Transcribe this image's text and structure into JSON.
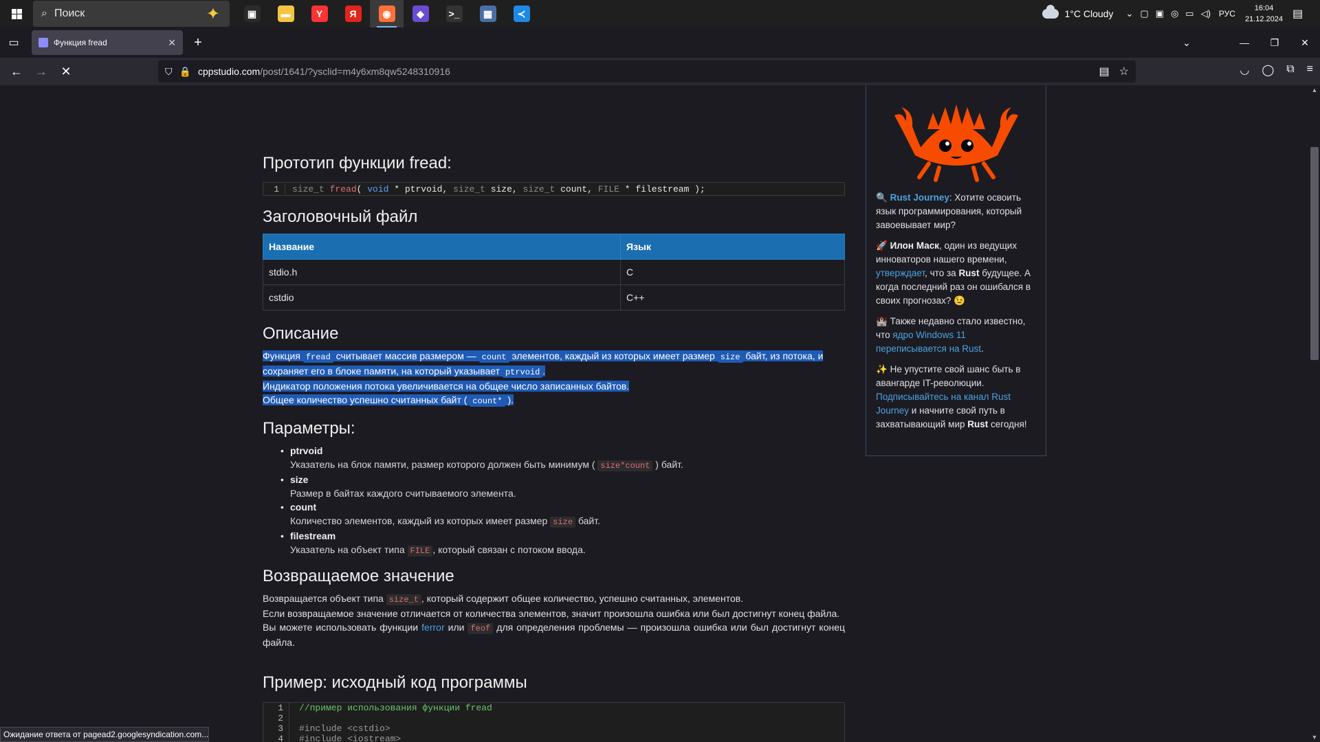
{
  "taskbar": {
    "search_placeholder": "Поиск",
    "apps": [
      {
        "name": "task-view",
        "color": "#2b2b2b",
        "glyph": "▣"
      },
      {
        "name": "file-explorer",
        "color": "#f5c542",
        "glyph": "▬"
      },
      {
        "name": "yandex-browser",
        "color": "#ff3333",
        "glyph": "Y"
      },
      {
        "name": "yandex",
        "color": "#e1251b",
        "glyph": "Я"
      },
      {
        "name": "firefox",
        "color": "#ff7139",
        "glyph": "◉"
      },
      {
        "name": "app-purple",
        "color": "#6b4bd1",
        "glyph": "◆"
      },
      {
        "name": "terminal",
        "color": "#333333",
        "glyph": ">_"
      },
      {
        "name": "calculator",
        "color": "#4a6fa5",
        "glyph": "▦"
      },
      {
        "name": "vscode",
        "color": "#1e88e5",
        "glyph": "≺"
      }
    ],
    "weather": "1°C  Cloudy",
    "lang": "РУС",
    "time": "16:04",
    "date": "21.12.2024"
  },
  "browser": {
    "tab_title": "Функция fread",
    "url_host": "cppstudio.com",
    "url_path": "/post/1641/?ysclid=m4y6xm8qw5248310916"
  },
  "article": {
    "prototype_heading": "Прототип функции fread:",
    "prototype_line_no": "1",
    "header_heading": "Заголовочный файл",
    "table": {
      "headers": [
        "Название",
        "Язык"
      ],
      "rows": [
        [
          "stdio.h",
          "C"
        ],
        [
          "cstdio",
          "C++"
        ]
      ]
    },
    "desc_heading": "Описание",
    "desc": {
      "p1_a": "Функция",
      "p1_code1": "fread",
      "p1_b": "считывает массив размером —",
      "p1_code2": "count",
      "p1_c": "элементов, каждый из которых имеет размер",
      "p1_code3": "size",
      "p1_d": "байт, из потока, и сохраняет его в блоке памяти, на который указывает",
      "p1_code4": "ptrvoid",
      "p1_e": ".",
      "p2": "Индикатор положения потока увеличивается на общее число записанных байтов.",
      "p3_a": "Общее количество успешно считанных байт (",
      "p3_code": "count*",
      "p3_b": ")."
    },
    "params_heading": "Параметры:",
    "params": [
      {
        "name": "ptrvoid",
        "desc_a": "Указатель на блок памяти, размер которого должен быть минимум  (",
        "code": "size*count",
        "desc_b": ") байт."
      },
      {
        "name": "size",
        "desc_a": "Размер в байтах каждого считываемого элемента.",
        "code": "",
        "desc_b": ""
      },
      {
        "name": "count",
        "desc_a": "Количество элементов, каждый из которых имеет размер",
        "code": "size",
        "desc_b": "байт."
      },
      {
        "name": "filestream",
        "desc_a": "Указатель на объект типа",
        "code": "FILE",
        "desc_b": ", который связан с потоком ввода."
      }
    ],
    "ret_heading": "Возвращаемое значение",
    "ret": {
      "p1_a": "Возвращается объект типа",
      "p1_code": "size_t",
      "p1_b": ", который содержит общее количество, успешно считанных, элементов.",
      "p2": "Если возвращаемое значение отличается от количества элементов, значит произошла ошибка или  был достигнут конец файла.",
      "p3_a": "Вы можете использовать функции",
      "p3_link": "ferror",
      "p3_b": "или",
      "p3_code": "feof",
      "p3_c": "для определения проблемы — произошла ошибка или был достигнут конец файла."
    },
    "example_heading": "Пример: исходный код программы",
    "example_lines": [
      {
        "no": "1",
        "text": "//пример использования функции fread",
        "kind": "comment"
      },
      {
        "no": "2",
        "text": "",
        "kind": "plain"
      },
      {
        "no": "3",
        "text": "#include <cstdio>",
        "kind": "pre"
      },
      {
        "no": "4",
        "text": "#include <iostream>",
        "kind": "pre"
      }
    ]
  },
  "sidebar": {
    "p1_em": "Rust Journey",
    "p1_rest": ": Хотите освоить язык программирования, который завоевывает мир?",
    "p2_bold": "Илон Маск",
    "p2_a": ", один из ведущих инноваторов нашего времени,",
    "p2_link": "утверждает",
    "p2_b": ", что за",
    "p2_bold2": "Rust",
    "p2_c": "будущее. А когда последний раз он ошибался в своих прогнозах?",
    "p3_a": "Также недавно стало известно, что",
    "p3_link": "ядро Windows 11 переписывается на Rust",
    "p3_b": ".",
    "p4_a": "Не упустите свой шанс быть в авангарде IT-революции.",
    "p4_link": "Подписывайтесь на канал Rust Journey",
    "p4_b": "и начните свой путь в захватывающий мир",
    "p4_bold": "Rust",
    "p4_c": "сегодня!"
  },
  "status_text": "Ожидание ответа от pagead2.googlesyndication.com..."
}
